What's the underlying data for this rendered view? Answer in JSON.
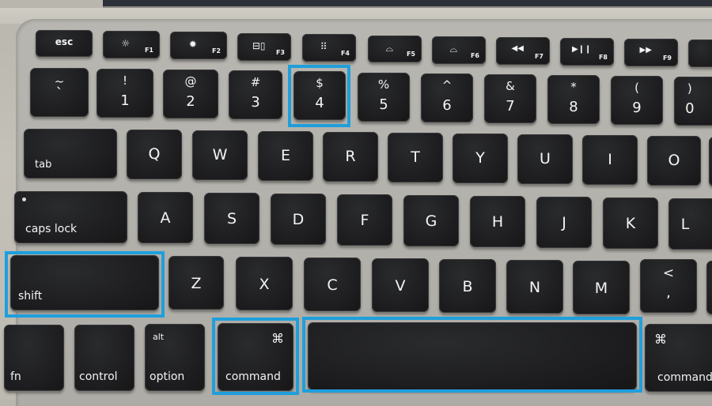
{
  "image": {
    "description": "Close-up photo of a laptop keyboard with several keys outlined in blue",
    "highlight_color": "#1f9fdc",
    "highlighted_keys": [
      "4",
      "shift",
      "command",
      "space"
    ]
  },
  "function_row": [
    {
      "main": "esc",
      "sub": ""
    },
    {
      "icon": "brightness-down-icon",
      "glyph": "☼",
      "sub": "F1"
    },
    {
      "icon": "brightness-up-icon",
      "glyph": "✹",
      "sub": "F2"
    },
    {
      "icon": "mission-control-icon",
      "glyph": "⊟▯",
      "sub": "F3"
    },
    {
      "icon": "launchpad-icon",
      "glyph": "⠿",
      "sub": "F4"
    },
    {
      "icon": "keyboard-light-down-icon",
      "glyph": "⌓",
      "sub": "F5"
    },
    {
      "icon": "keyboard-light-up-icon",
      "glyph": "⌓",
      "sub": "F6"
    },
    {
      "icon": "rewind-icon",
      "glyph": "◀◀",
      "sub": "F7"
    },
    {
      "icon": "play-pause-icon",
      "glyph": "▶❙❙",
      "sub": "F8"
    },
    {
      "icon": "fast-forward-icon",
      "glyph": "▶▶",
      "sub": "F9"
    }
  ],
  "number_row": [
    {
      "top": "~",
      "bottom": "`"
    },
    {
      "top": "!",
      "bottom": "1"
    },
    {
      "top": "@",
      "bottom": "2"
    },
    {
      "top": "#",
      "bottom": "3"
    },
    {
      "top": "$",
      "bottom": "4"
    },
    {
      "top": "%",
      "bottom": "5"
    },
    {
      "top": "^",
      "bottom": "6"
    },
    {
      "top": "&",
      "bottom": "7"
    },
    {
      "top": "*",
      "bottom": "8"
    },
    {
      "top": "(",
      "bottom": "9"
    },
    {
      "top": ")",
      "bottom": "0"
    }
  ],
  "qwerty_row": {
    "tab": "tab",
    "letters": [
      "Q",
      "W",
      "E",
      "R",
      "T",
      "Y",
      "U",
      "I",
      "O"
    ]
  },
  "home_row": {
    "caps": "caps lock",
    "letters": [
      "A",
      "S",
      "D",
      "F",
      "G",
      "H",
      "J",
      "K",
      "L"
    ]
  },
  "shift_row": {
    "shift": "shift",
    "letters": [
      "Z",
      "X",
      "C",
      "V",
      "B",
      "N",
      "M"
    ],
    "comma_top": "<",
    "comma_bottom": ","
  },
  "bottom_row": {
    "fn": "fn",
    "control": "control",
    "option_top": "alt",
    "option": "option",
    "command_symbol": "⌘",
    "command": "command",
    "space": "",
    "command_right_symbol": "⌘",
    "command_right": "command"
  }
}
